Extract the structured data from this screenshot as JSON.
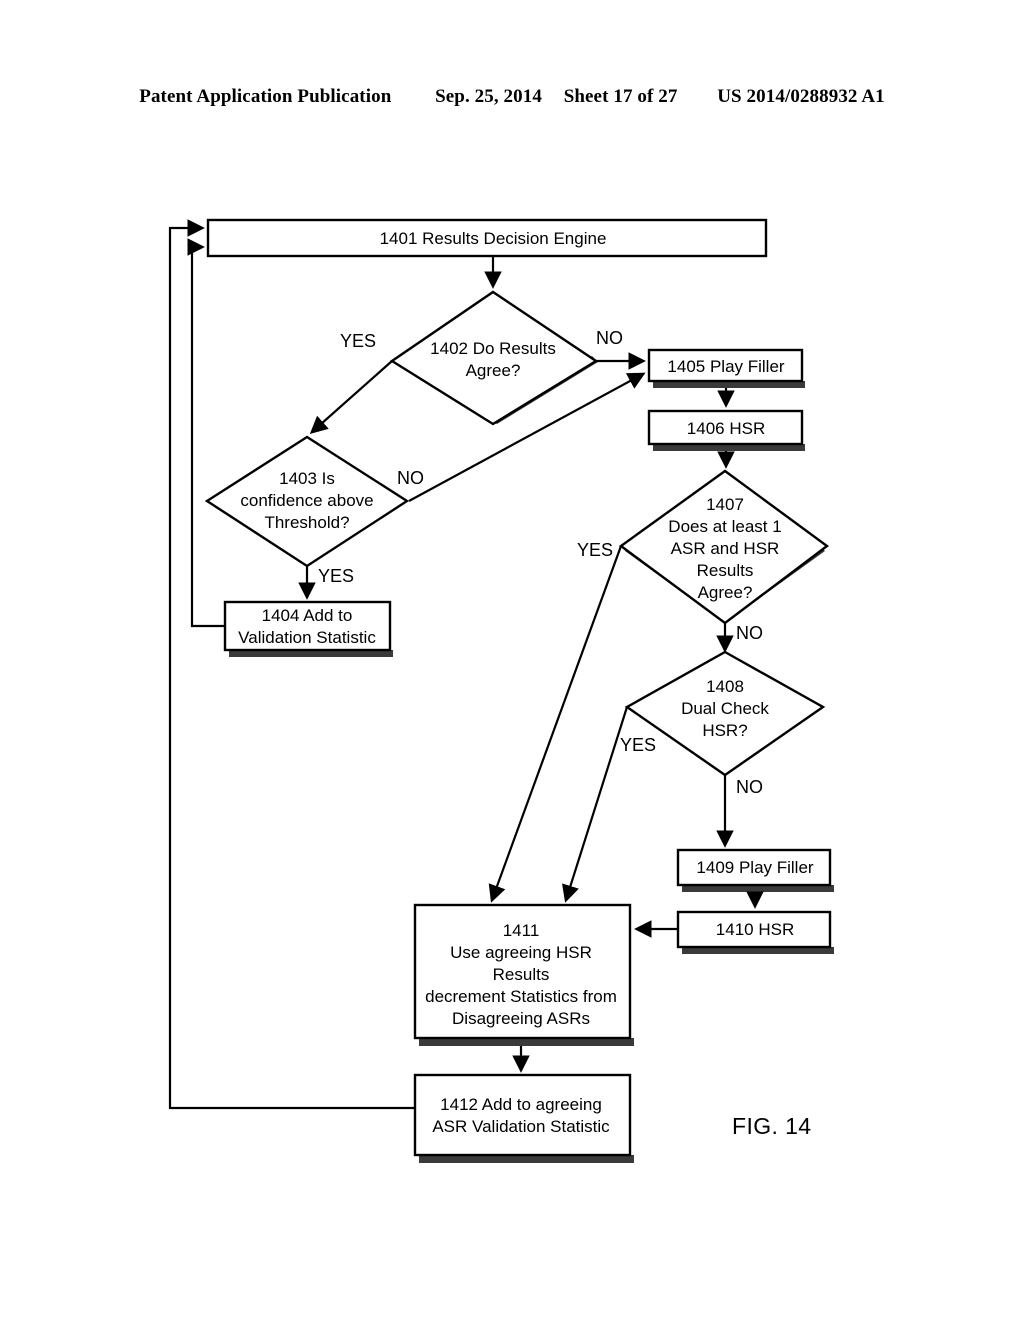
{
  "header": {
    "publication": "Patent Application Publication",
    "date": "Sep. 25, 2014",
    "sheet": "Sheet 17 of 27",
    "patent_number": "US 2014/0288932 A1"
  },
  "figure": {
    "caption": "FIG. 14"
  },
  "colors": {
    "stroke": "#000000",
    "background": "#ffffff",
    "shadow": "#3a3a3a"
  },
  "chart_data": {
    "type": "diagram",
    "title": "FIG. 14",
    "nodes": [
      {
        "id": "1401",
        "shape": "process",
        "lines": [
          "1401 Results Decision Engine"
        ]
      },
      {
        "id": "1402",
        "shape": "decision",
        "lines": [
          "1402 Do Results",
          "Agree?"
        ]
      },
      {
        "id": "1403",
        "shape": "decision",
        "lines": [
          "1403 Is",
          "confidence above",
          "Threshold?"
        ]
      },
      {
        "id": "1404",
        "shape": "process",
        "lines": [
          "1404 Add to",
          "Validation Statistic"
        ]
      },
      {
        "id": "1405",
        "shape": "process",
        "lines": [
          "1405 Play Filler"
        ]
      },
      {
        "id": "1406",
        "shape": "process",
        "lines": [
          "1406 HSR"
        ]
      },
      {
        "id": "1407",
        "shape": "decision",
        "lines": [
          "1407",
          "Does at least 1",
          "ASR and HSR",
          "Results",
          "Agree?"
        ]
      },
      {
        "id": "1408",
        "shape": "decision",
        "lines": [
          "1408",
          "Dual Check",
          "HSR?"
        ]
      },
      {
        "id": "1409",
        "shape": "process",
        "lines": [
          "1409 Play Filler"
        ]
      },
      {
        "id": "1410",
        "shape": "process",
        "lines": [
          "1410 HSR"
        ]
      },
      {
        "id": "1411",
        "shape": "process",
        "lines": [
          "1411",
          "Use agreeing HSR",
          "Results",
          "decrement Statistics from",
          "Disagreeing ASRs"
        ]
      },
      {
        "id": "1412",
        "shape": "process",
        "lines": [
          "1412 Add to agreeing",
          "ASR  Validation Statistic"
        ]
      }
    ],
    "edges": [
      {
        "from": "1401",
        "to": "1402",
        "label": ""
      },
      {
        "from": "1402",
        "to": "1403",
        "label": "YES"
      },
      {
        "from": "1402",
        "to": "1405",
        "label": "NO"
      },
      {
        "from": "1403",
        "to": "1404",
        "label": "YES"
      },
      {
        "from": "1403",
        "to": "1405",
        "label": "NO"
      },
      {
        "from": "1404",
        "to": "1401",
        "label": ""
      },
      {
        "from": "1405",
        "to": "1406",
        "label": ""
      },
      {
        "from": "1406",
        "to": "1407",
        "label": ""
      },
      {
        "from": "1407",
        "to": "1411",
        "label": "YES"
      },
      {
        "from": "1407",
        "to": "1408",
        "label": "NO"
      },
      {
        "from": "1408",
        "to": "1411",
        "label": "YES"
      },
      {
        "from": "1408",
        "to": "1409",
        "label": "NO"
      },
      {
        "from": "1409",
        "to": "1410",
        "label": ""
      },
      {
        "from": "1410",
        "to": "1411",
        "label": ""
      },
      {
        "from": "1411",
        "to": "1412",
        "label": ""
      },
      {
        "from": "1412",
        "to": "1401",
        "label": ""
      }
    ]
  },
  "nodes": {
    "n1401": {
      "line1": "1401 Results Decision Engine"
    },
    "n1402": {
      "line1": "1402 Do Results",
      "line2": "Agree?"
    },
    "n1403": {
      "line1": "1403 Is",
      "line2": "confidence above",
      "line3": "Threshold?"
    },
    "n1404": {
      "line1": "1404 Add to",
      "line2": "Validation Statistic"
    },
    "n1405": {
      "line1": "1405 Play Filler"
    },
    "n1406": {
      "line1": "1406 HSR"
    },
    "n1407": {
      "line1": "1407",
      "line2": "Does at least 1",
      "line3": "ASR and HSR",
      "line4": "Results",
      "line5": "Agree?"
    },
    "n1408": {
      "line1": "1408",
      "line2": "Dual Check",
      "line3": "HSR?"
    },
    "n1409": {
      "line1": "1409 Play Filler"
    },
    "n1410": {
      "line1": "1410 HSR"
    },
    "n1411": {
      "line1": "1411",
      "line2": "Use agreeing HSR",
      "line3": "Results",
      "line4": "decrement Statistics from",
      "line5": "Disagreeing ASRs"
    },
    "n1412": {
      "line1": "1412 Add to agreeing",
      "line2": "ASR  Validation Statistic"
    }
  },
  "labels": {
    "yes_1402": "YES",
    "no_1402": "NO",
    "yes_1403": "YES",
    "no_1403": "NO",
    "yes_1407": "YES",
    "no_1407": "NO",
    "yes_1408": "YES",
    "no_1408": "NO"
  }
}
